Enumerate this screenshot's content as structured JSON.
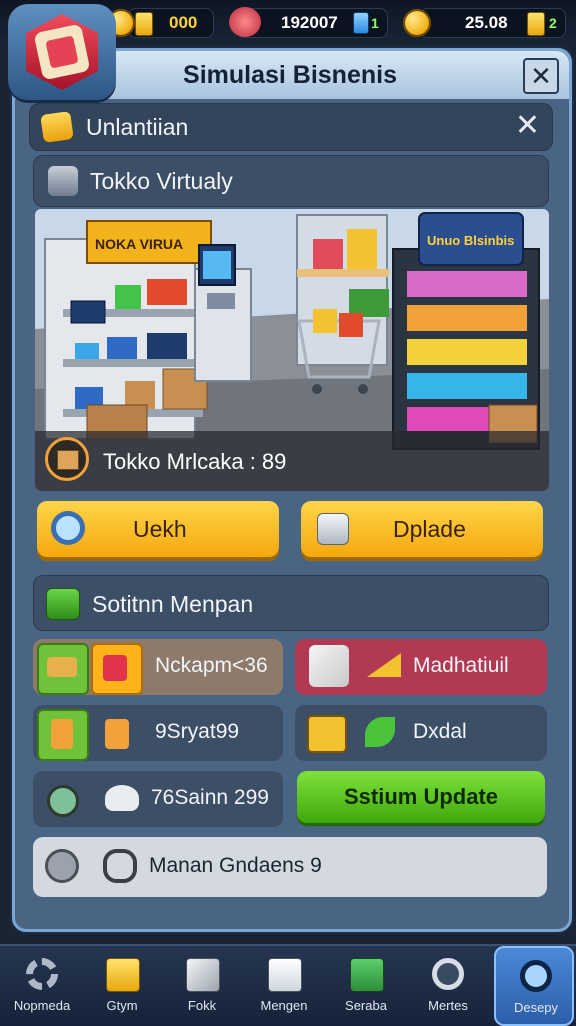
{
  "resources": {
    "gold_value": "000",
    "cash_value": "192007",
    "cash_badge": "1",
    "coins_value": "25.08",
    "coins_badge": "2"
  },
  "window": {
    "title": "Simulasi Bisnenis"
  },
  "notice": {
    "title": "Unlantiian"
  },
  "store": {
    "header": "Tokko Virtualy",
    "sign_left": "NOKA VIRUA",
    "sign_right": "Unuo Blsinbis",
    "status": "Tokko Mrlcaka : 89"
  },
  "actions": {
    "button_left": "Uekh",
    "button_right": "Dplade"
  },
  "section": {
    "title": "Sotitnn Menpan"
  },
  "rows": {
    "r1_left": "Nckapm<36",
    "r1_right": "Madhatiuil",
    "r2_left": "9Sryat99",
    "r2_right": "Dxdal",
    "r3_left": "76Sainn 299",
    "r3_button": "Sstium Update",
    "r4_text": "Manan Gndaens 9"
  },
  "nav": [
    {
      "label": "Nopmeda"
    },
    {
      "label": "Gtym"
    },
    {
      "label": "Fokk"
    },
    {
      "label": "Mengen"
    },
    {
      "label": "Seraba"
    },
    {
      "label": "Mertes"
    },
    {
      "label": "Desepy"
    }
  ],
  "colors": {
    "accent_yellow": "#f5a80e",
    "accent_green": "#3fa80e",
    "panel": "#3c4f66",
    "row_red": "#b13a52"
  }
}
